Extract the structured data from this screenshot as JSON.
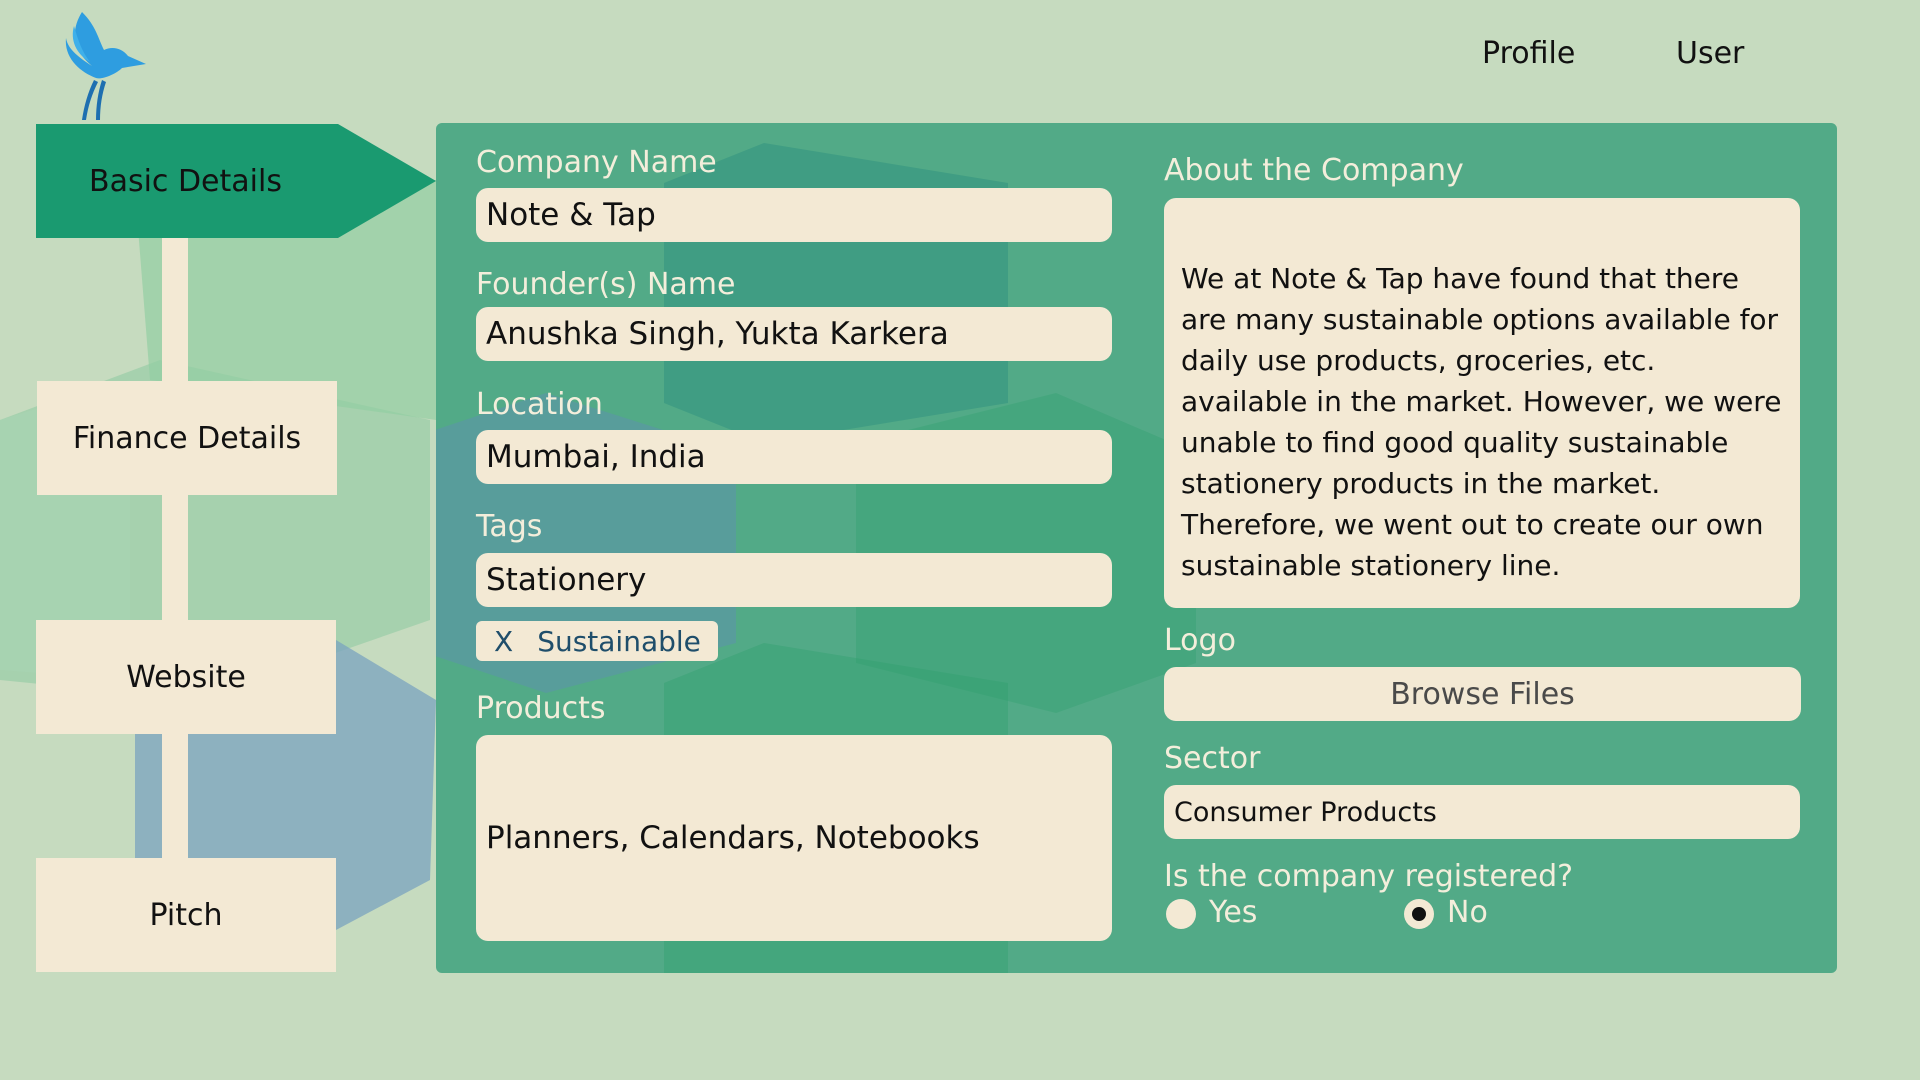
{
  "nav": {
    "profile": "Profile",
    "user": "User"
  },
  "steps": [
    {
      "label": "Basic Details"
    },
    {
      "label": "Finance Details"
    },
    {
      "label": "Website"
    },
    {
      "label": "Pitch"
    }
  ],
  "form": {
    "company_name": {
      "label": "Company Name",
      "value": "Note & Tap"
    },
    "founders": {
      "label": "Founder(s) Name",
      "value": "Anushka Singh, Yukta Karkera"
    },
    "location": {
      "label": "Location",
      "value": "Mumbai, India"
    },
    "tags": {
      "label": "Tags",
      "value": "Stationery",
      "chips": [
        {
          "remove": "X",
          "label": "Sustainable"
        }
      ]
    },
    "products": {
      "label": "Products",
      "value": "Planners, Calendars, Notebooks"
    },
    "about": {
      "label": "About the Company",
      "value": "We at Note & Tap have found that there are many sustainable options available for daily use products, groceries, etc. available in the market. However, we were unable to find good quality sustainable stationery products in the market. Therefore, we went out to create our own sustainable stationery line."
    },
    "logo": {
      "label": "Logo",
      "button": "Browse Files"
    },
    "sector": {
      "label": "Sector",
      "value": "Consumer Products"
    },
    "registered": {
      "label": "Is the company registered?",
      "yes": "Yes",
      "no": "No",
      "selected": "No"
    }
  },
  "colors": {
    "background": "#c6dbbf",
    "panel": "#42a37f",
    "active_step": "#1a9a70",
    "field": "#f3e9d4",
    "logo": "#2e9de0"
  },
  "icons": {
    "logo": "bird-logo-icon",
    "radio": "radio-icon"
  }
}
